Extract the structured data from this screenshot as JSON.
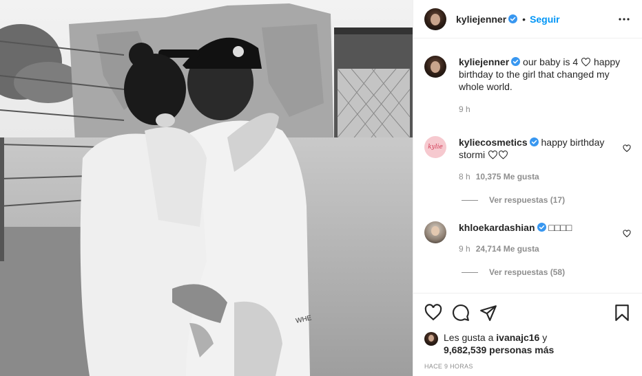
{
  "post": {
    "username": "kyliejenner",
    "follow_label": "Seguir",
    "separator": "•"
  },
  "caption": {
    "username": "kyliejenner",
    "text_before": "our baby is 4",
    "text_after": "happy birthday to the girl that changed my whole world.",
    "time": "9 h"
  },
  "comments": [
    {
      "username": "kyliecosmetics",
      "avatar_text": "kylie",
      "text": "happy birthday stormi",
      "time": "8 h",
      "likes": "10,375 Me gusta",
      "replies": "Ver respuestas (17)"
    },
    {
      "username": "khloekardashian",
      "text": "□□□□",
      "time": "9 h",
      "likes": "24,714 Me gusta",
      "replies": "Ver respuestas (58)"
    }
  ],
  "likes": {
    "prefix": "Les gusta a",
    "user": "ivanajc16",
    "conj": "y",
    "others": "9,682,539 personas más"
  },
  "timestamp": "HACE 9 HORAS",
  "photo_text": "WHE",
  "colors": {
    "link": "#0095f6",
    "verified": "#3897f0",
    "secondary_text": "#8e8e8e",
    "border": "#efefef"
  },
  "icons": [
    "verified-badge-icon",
    "more-options-icon",
    "heart-icon",
    "comment-icon",
    "share-icon",
    "save-icon",
    "heart-small-icon"
  ]
}
